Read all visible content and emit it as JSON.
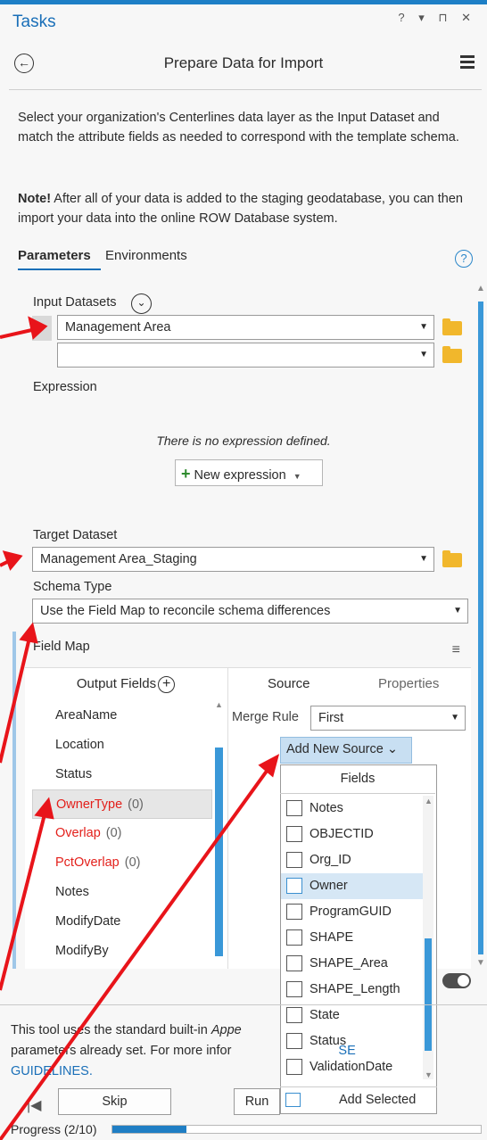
{
  "pane": {
    "title": "Tasks",
    "controls": "? ▾ ⊓ ✕"
  },
  "header": {
    "title": "Prepare Data for Import"
  },
  "description": "Select your organization's Centerlines data layer as the Input Dataset and match the attribute fields as needed to correspond with the template schema.",
  "note": {
    "bold": "Note!",
    "text": " After all of your data is added to the staging geodatabase, you can then import your data into the online ROW Database system."
  },
  "tabs": {
    "parameters": "Parameters",
    "environments": "Environments"
  },
  "input_datasets": {
    "label": "Input Datasets",
    "values": [
      "Management Area",
      ""
    ]
  },
  "expression": {
    "label": "Expression",
    "empty_text": "There is no expression defined.",
    "new_button": "New expression"
  },
  "target_dataset": {
    "label": "Target Dataset",
    "value": "Management Area_Staging"
  },
  "schema_type": {
    "label": "Schema Type",
    "value": "Use the Field Map to reconcile schema differences"
  },
  "field_map": {
    "label": "Field Map",
    "output_header": "Output Fields",
    "source_tab": "Source",
    "properties_tab": "Properties",
    "merge_rule_label": "Merge Rule",
    "merge_rule_value": "First",
    "add_source_label": "Add New Source",
    "output_fields": [
      {
        "name": "AreaName",
        "count": ""
      },
      {
        "name": "Location",
        "count": ""
      },
      {
        "name": "Status",
        "count": ""
      },
      {
        "name": "OwnerType",
        "count": "(0)"
      },
      {
        "name": "Overlap",
        "count": "(0)"
      },
      {
        "name": "PctOverlap",
        "count": "(0)"
      },
      {
        "name": "Notes",
        "count": ""
      },
      {
        "name": "ModifyDate",
        "count": ""
      },
      {
        "name": "ModifyBy",
        "count": ""
      }
    ],
    "fields_popup": {
      "header": "Fields",
      "items": [
        "Notes",
        "OBJECTID",
        "Org_ID",
        "Owner",
        "ProgramGUID",
        "SHAPE",
        "SHAPE_Area",
        "SHAPE_Length",
        "State",
        "Status",
        "ValidationDate"
      ],
      "add_selected": "Add Selected"
    }
  },
  "info": {
    "line1": "This tool uses the standard built-in ",
    "italic": "Appe",
    "line2": "parameters already set. For more infor",
    "link_tail": "SE",
    "link2": "GUIDELINES."
  },
  "buttons": {
    "skip": "Skip",
    "run": "Run"
  },
  "progress": {
    "label": "Progress (2/10)",
    "fraction": 0.2
  },
  "colors": {
    "accent": "#1a6fb8",
    "required_field": "#e3201b",
    "annotation_arrow": "#e8141a"
  }
}
